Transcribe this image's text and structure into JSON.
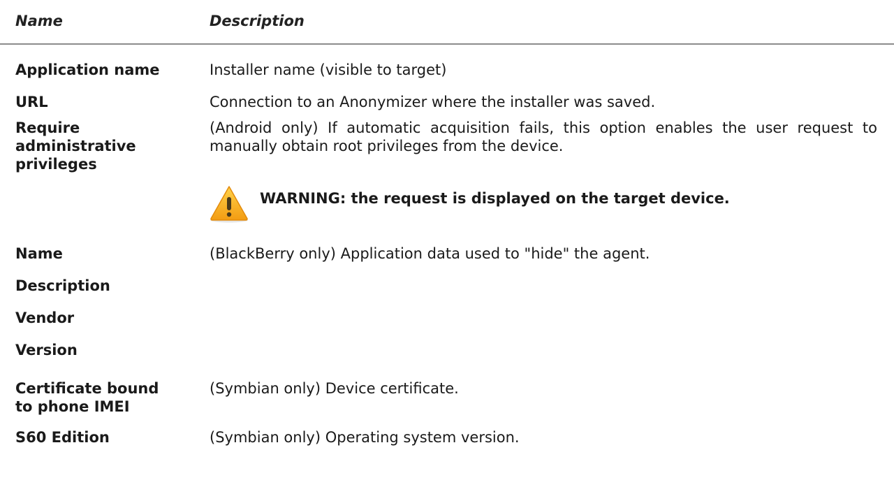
{
  "header": {
    "name_label": "Name",
    "description_label": "Description"
  },
  "rows": [
    {
      "name_lines": [
        "Application name"
      ],
      "description": "Installer name (visible to target)"
    },
    {
      "name_lines": [
        "URL"
      ],
      "description": "Connection to an Anonymizer where the installer was saved."
    },
    {
      "name_lines": [
        "Require",
        "administrative",
        "privileges"
      ],
      "description": "(Android only) If automatic acquisition fails, this option enables the user request to manually obtain root privileges from the device."
    },
    {
      "name_lines": [
        "Name"
      ],
      "description": "(BlackBerry only) Application data used to \"hide\" the agent."
    },
    {
      "name_lines": [
        "Description"
      ],
      "description": ""
    },
    {
      "name_lines": [
        "Vendor"
      ],
      "description": ""
    },
    {
      "name_lines": [
        "Version"
      ],
      "description": ""
    },
    {
      "name_lines": [
        "Certificate bound",
        "to phone IMEI"
      ],
      "description": "(Symbian only) Device certificate."
    },
    {
      "name_lines": [
        "S60 Edition"
      ],
      "description": "(Symbian only) Operating system version."
    }
  ],
  "warning": {
    "icon": "warning-triangle-icon",
    "text": "WARNING: the request is displayed on the target device.",
    "icon_color": "#f5a623"
  },
  "colors": {
    "divider": "#8c8c8c",
    "text": "#1a1a1a"
  }
}
